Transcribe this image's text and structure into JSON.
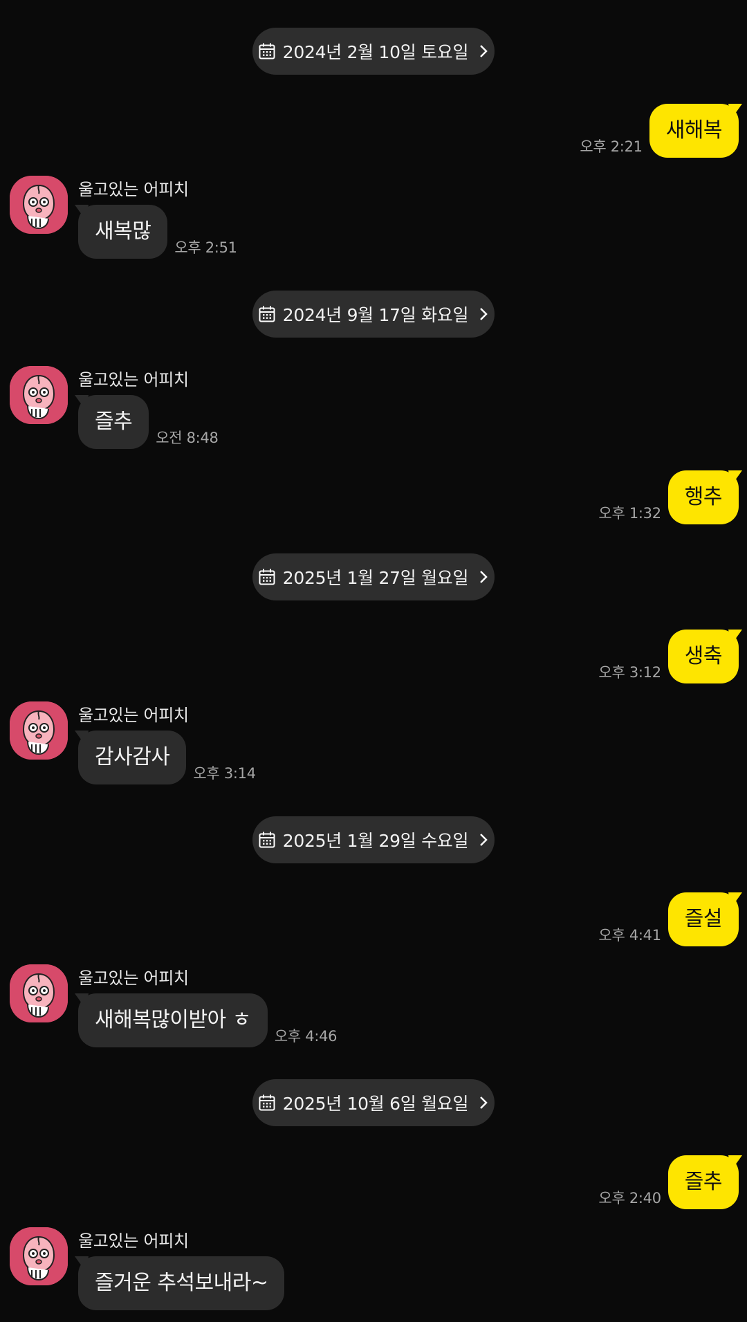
{
  "accent_color": "#fee500",
  "other_bubble_color": "#2c2c2c",
  "date_pill_color": "#2e2e2e",
  "avatar_color": "#d74a6a",
  "icons": {
    "date_pill": "calendar-icon",
    "date_pill_arrow": "chevron-right-icon",
    "avatar": "crying-apeach-avatar"
  },
  "dates": [
    "2024년 2월 10일 토요일",
    "2024년 9월 17일 화요일",
    "2025년 1월 27일 월요일",
    "2025년 1월 29일 수요일",
    "2025년 10월 6일 월요일"
  ],
  "messages": [
    {
      "from": "me",
      "text": "새해복",
      "time": "오후 2:21"
    },
    {
      "from": "other",
      "sender": "울고있는 어피치",
      "text": "새복많",
      "time": "오후 2:51"
    },
    {
      "from": "other",
      "sender": "울고있는 어피치",
      "text": "즐추",
      "time": "오전 8:48"
    },
    {
      "from": "me",
      "text": "행추",
      "time": "오후 1:32"
    },
    {
      "from": "me",
      "text": "생축",
      "time": "오후 3:12"
    },
    {
      "from": "other",
      "sender": "울고있는 어피치",
      "text": "감사감사",
      "time": "오후 3:14"
    },
    {
      "from": "me",
      "text": "즐설",
      "time": "오후 4:41"
    },
    {
      "from": "other",
      "sender": "울고있는 어피치",
      "text": "새해복많이받아 ㅎ",
      "time": "오후 4:46"
    },
    {
      "from": "me",
      "text": "즐추",
      "time": "오후 2:40"
    },
    {
      "from": "other",
      "sender": "울고있는 어피치",
      "text": "즐거운 추석보내라~",
      "time": ""
    }
  ]
}
